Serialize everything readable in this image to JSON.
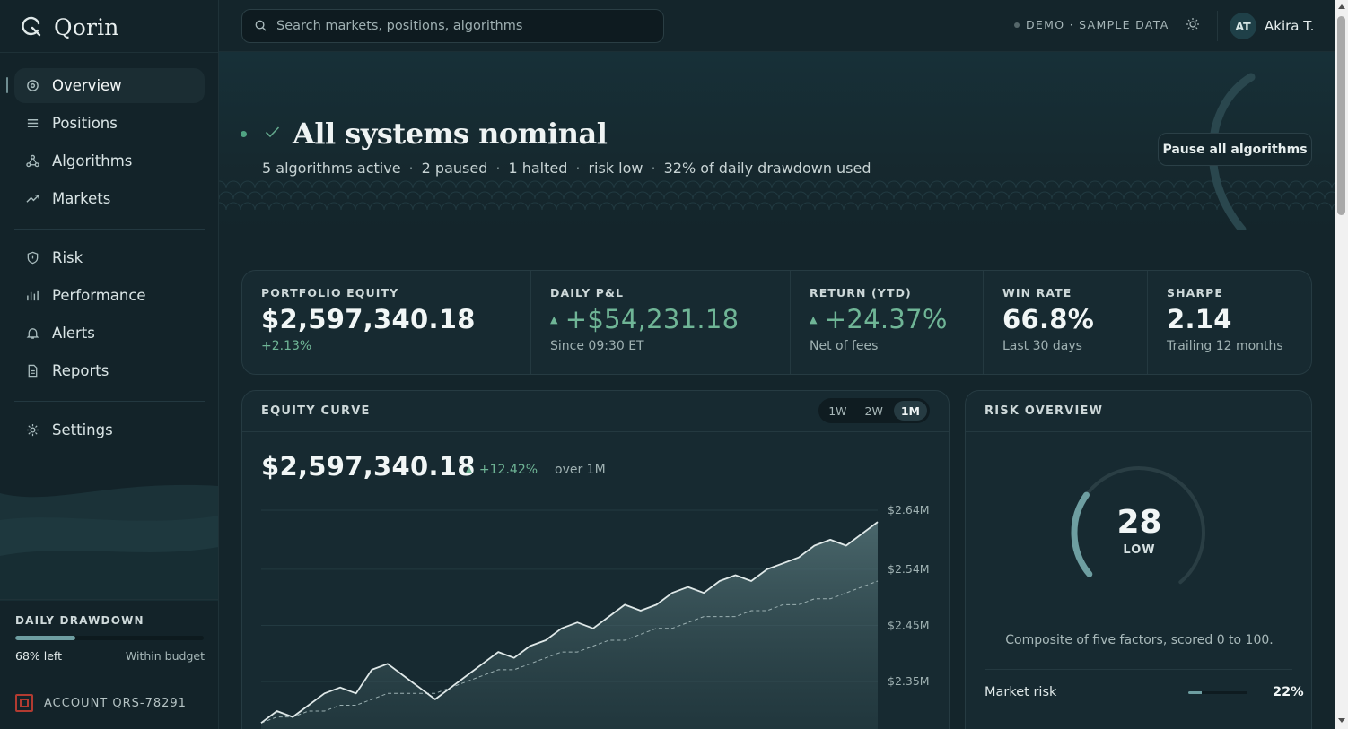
{
  "app": {
    "name": "Qorin"
  },
  "search": {
    "placeholder": "Search markets, positions, algorithms"
  },
  "topbar": {
    "demo_label": "DEMO · SAMPLE DATA",
    "user_initials": "AT",
    "user_name": "Akira T."
  },
  "sidebar": {
    "items": [
      {
        "label": "Overview",
        "icon": "overview-icon",
        "active": true
      },
      {
        "label": "Positions",
        "icon": "list-icon"
      },
      {
        "label": "Algorithms",
        "icon": "algorithm-icon"
      },
      {
        "label": "Markets",
        "icon": "trend-icon"
      },
      {
        "label": "Risk",
        "icon": "shield-icon"
      },
      {
        "label": "Performance",
        "icon": "bar-chart-icon"
      },
      {
        "label": "Alerts",
        "icon": "bell-icon"
      },
      {
        "label": "Reports",
        "icon": "document-icon"
      },
      {
        "label": "Settings",
        "icon": "gear-icon"
      }
    ],
    "drawdown": {
      "title": "DAILY DRAWDOWN",
      "left_label": "68% left",
      "status": "Within budget",
      "remaining_fraction": 0.32
    },
    "account": "ACCOUNT QRS-78291"
  },
  "hero": {
    "title": "All systems nominal",
    "summary": [
      "5 algorithms active",
      "2 paused",
      "1 halted",
      "risk low",
      "32% of daily drawdown used"
    ],
    "pause_button": "Pause all algorithms"
  },
  "kpis": [
    {
      "label": "PORTFOLIO EQUITY",
      "value": "$2,597,340.18",
      "sub": "+2.13%",
      "sub_positive": true
    },
    {
      "label": "DAILY P&L",
      "value": "+$54,231.18",
      "sub": "Since 09:30 ET",
      "positive": true
    },
    {
      "label": "RETURN (YTD)",
      "value": "+24.37%",
      "sub": "Net of fees",
      "positive": true
    },
    {
      "label": "WIN RATE",
      "value": "66.8%",
      "sub": "Last 30 days"
    },
    {
      "label": "SHARPE",
      "value": "2.14",
      "sub": "Trailing 12 months"
    }
  ],
  "equity": {
    "title": "EQUITY CURVE",
    "ranges": [
      "1W",
      "2W",
      "1M"
    ],
    "active_range": "1M",
    "value": "$2,597,340.18",
    "change": "+12.42%",
    "period": "over 1M"
  },
  "chart_data": {
    "type": "area",
    "yticks": [
      "$2.64M",
      "$2.54M",
      "$2.45M",
      "$2.35M"
    ],
    "ylim": [
      2.25,
      2.69
    ],
    "series": [
      {
        "values": [
          2.28,
          2.3,
          2.29,
          2.31,
          2.33,
          2.34,
          2.33,
          2.37,
          2.38,
          2.36,
          2.34,
          2.32,
          2.34,
          2.36,
          2.38,
          2.4,
          2.39,
          2.41,
          2.42,
          2.44,
          2.45,
          2.44,
          2.46,
          2.48,
          2.47,
          2.48,
          2.5,
          2.51,
          2.5,
          2.52,
          2.53,
          2.52,
          2.54,
          2.55,
          2.56,
          2.58,
          2.59,
          2.58,
          2.6,
          2.62
        ]
      },
      {
        "values": [
          2.28,
          2.29,
          2.29,
          2.3,
          2.3,
          2.31,
          2.31,
          2.32,
          2.33,
          2.33,
          2.33,
          2.33,
          2.34,
          2.35,
          2.36,
          2.37,
          2.37,
          2.38,
          2.39,
          2.4,
          2.4,
          2.41,
          2.42,
          2.42,
          2.43,
          2.44,
          2.44,
          2.45,
          2.46,
          2.46,
          2.46,
          2.47,
          2.47,
          2.48,
          2.48,
          2.49,
          2.49,
          2.5,
          2.51,
          2.52
        ],
        "dashed": true
      }
    ]
  },
  "risk": {
    "title": "RISK OVERVIEW",
    "score": "28",
    "level": "LOW",
    "score_value": 28,
    "note": "Composite of five factors, scored 0 to 100.",
    "factors": [
      {
        "label": "Market risk",
        "value": "22%",
        "fraction": 0.22
      }
    ]
  },
  "colors": {
    "accent": "#6e9ea1",
    "positive": "#6fb596",
    "status_dot": "#4fa382",
    "seal": "#b23b31"
  }
}
